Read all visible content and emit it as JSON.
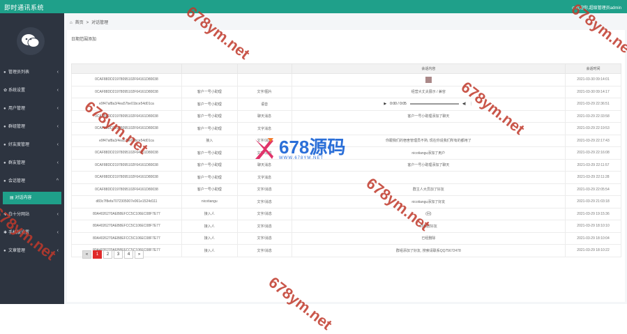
{
  "app": {
    "title": "即时通讯系统",
    "welcome": "◎欢迎你,超级管理员admin"
  },
  "sidebar": {
    "items": [
      {
        "label": "管理员列表",
        "icon": "user-icon",
        "caret": "‹"
      },
      {
        "label": "系统设置",
        "icon": "gear-icon",
        "caret": "‹"
      },
      {
        "label": "用户管理",
        "icon": "users-icon",
        "caret": "‹"
      },
      {
        "label": "群组管理",
        "icon": "group-icon",
        "caret": "‹"
      },
      {
        "label": "好友度管理",
        "icon": "friends-icon",
        "caret": "‹"
      },
      {
        "label": "群友管理",
        "icon": "group-friends-icon",
        "caret": "‹"
      },
      {
        "label": "会话管理",
        "icon": "chat-icon",
        "caret": "^"
      }
    ],
    "submenu": {
      "label": "对话内容",
      "icon": "list-icon"
    },
    "items_after": [
      {
        "label": "白十分网站",
        "icon": "site-icon",
        "caret": "‹"
      },
      {
        "label": "手机版设置",
        "icon": "mobile-icon",
        "caret": "‹"
      },
      {
        "label": "文章管理",
        "icon": "article-icon",
        "caret": "‹"
      }
    ]
  },
  "breadcrumb": {
    "home": "首页",
    "sep": ">",
    "current": "对话管理"
  },
  "filter_text": "日期范围添加",
  "table": {
    "headers": [
      "",
      "",
      "",
      "会话内容",
      "会话时间"
    ],
    "rows": [
      [
        "0CAF88DD21978095102F64161D80038",
        "",
        "",
        "[image]",
        "2021-03-30 09:14:01"
      ],
      [
        "0CAF88DD21978095102F64161D80038",
        "客户一号小助理",
        "文字/图片",
        "经营大丈夫展示 / 兼容",
        "2021-03-30 09:14:17"
      ],
      [
        "e9f47af8a3/4ea57be01bce54d01ca",
        "客户一号小助理",
        "语音",
        "[audio]",
        "2021-03-29 22:36:51"
      ],
      [
        "0CAF88DD21978095102F64161D80038",
        "客户一号小助理",
        "聊天消息",
        "客户一号小助理添加了聊天",
        "2021-03-29 22:33:58"
      ],
      [
        "0CAF88DD21978095102F64161D80038",
        "客户一号小助理",
        "文字消息",
        "",
        "2021-03-29 22:19:53"
      ],
      [
        "e9f47af8a3/4ea57be01bce54d01ca",
        "接入",
        "文字/消息",
        "你跟我们的宿舍管理员不熟, 现在你说我们所有的都用了",
        "2021-03-29 22:17:43"
      ],
      [
        "0CAF88DD21978095102F64161D80038",
        "客户一号小助理",
        "文字/消息",
        "nicotiangu添加了用户",
        "2021-03-29 22:16:08"
      ],
      [
        "0CAF88DD21978095102F64161D80038",
        "客户一号小助理",
        "聊天消息",
        "客户一号小助理添加了聊天",
        "2021-03-29 22:11:57"
      ],
      [
        "0CAF88DD21978095102F64161D80038",
        "客户一号小助理",
        "文字消息",
        "",
        "2021-03-29 22:11:28"
      ],
      [
        "0CAF88DD21978095102F64161D80038",
        "客户一号小助理",
        "文字/消息",
        "群主人大员加了好友",
        "2021-03-29 22:05:54"
      ],
      [
        "d83c7f8efa7072305007e061e1524d111",
        "nicotiangu",
        "文字/消息",
        "nicotiangu添加了好友",
        "2021-03-29 21:03:18"
      ],
      [
        "80A4026270AEB8EFCC5C106EC08F7E77",
        "接入人",
        "文字/消息",
        "(回)",
        "2021-03-29 19:15:36"
      ],
      [
        "80A4026270AEB8EFCC5C106EC08F7E77",
        "接入人",
        "文字/消息",
        "你和群好友",
        "2021-03-29 18:10:10"
      ],
      [
        "80A4026270AEB8EFCC5C106EC08F7E77",
        "接入人",
        "文字/消息",
        "已经删除",
        "2021-03-29 18:10:04"
      ],
      [
        "80A4026270AEB8EFCC5C106EC08F7E77",
        "接入人",
        "文字/消息",
        "群组添加了好友, 搜索请联系QQ75672478",
        "2021-03-29 18:10:22"
      ]
    ]
  },
  "audio": {
    "time": "0:00 / 0:05"
  },
  "pagination": {
    "prev": "«",
    "pages": [
      "1",
      "2",
      "3",
      "4"
    ],
    "next": "»",
    "current": "1"
  },
  "watermark": {
    "text": "678ym.net",
    "logo_text": "678源码",
    "logo_url": "WWW.678YM.NET"
  }
}
